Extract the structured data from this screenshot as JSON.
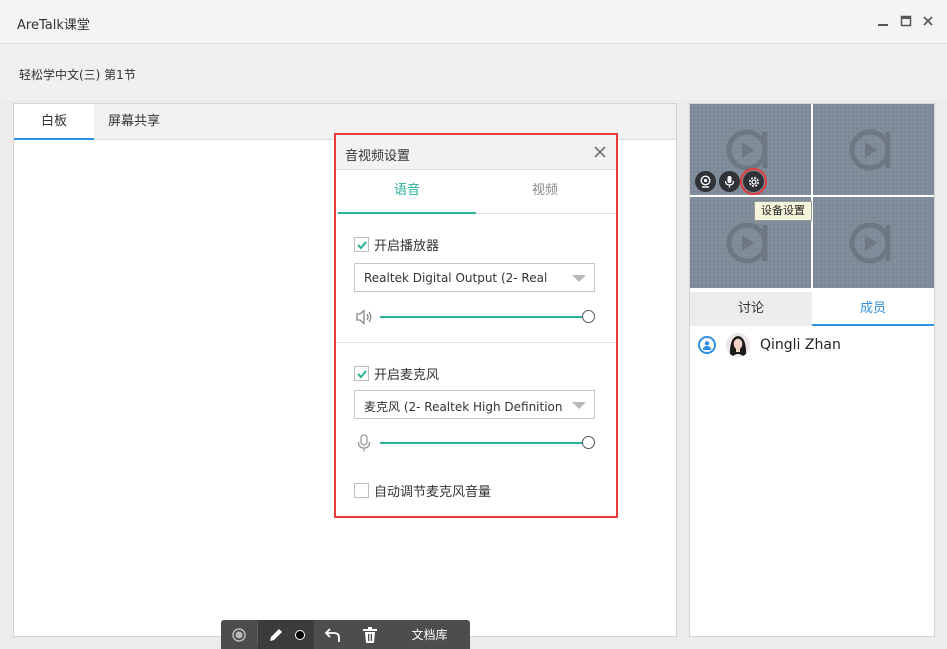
{
  "window": {
    "title": "AreTalk课堂",
    "lesson": "轻松学中文(三)   第1节"
  },
  "board": {
    "tabs": [
      "白板",
      "屏幕共享"
    ]
  },
  "toolbar": {
    "docs_label": "文档库"
  },
  "video": {
    "tooltip": "设备设置"
  },
  "side": {
    "tabs": [
      "讨论",
      "成员"
    ],
    "member_name": "Qingli Zhan"
  },
  "dialog": {
    "title": "音视频设置",
    "tabs": [
      "语音",
      "视频"
    ],
    "speaker_label": "开启播放器",
    "speaker_device": "Realtek Digital Output (2- Real",
    "mic_label": "开启麦克风",
    "mic_device": "麦克风 (2- Realtek High Definition",
    "auto_adjust_label": "自动调节麦克风音量",
    "speaker_checked": true,
    "mic_checked": true,
    "auto_adjust_checked": false,
    "speaker_volume": 1.0,
    "mic_volume": 1.0
  },
  "colors": {
    "accent_green": "#27b39a",
    "accent_blue": "#2f8fe0",
    "highlight_red": "#e83b3b"
  }
}
